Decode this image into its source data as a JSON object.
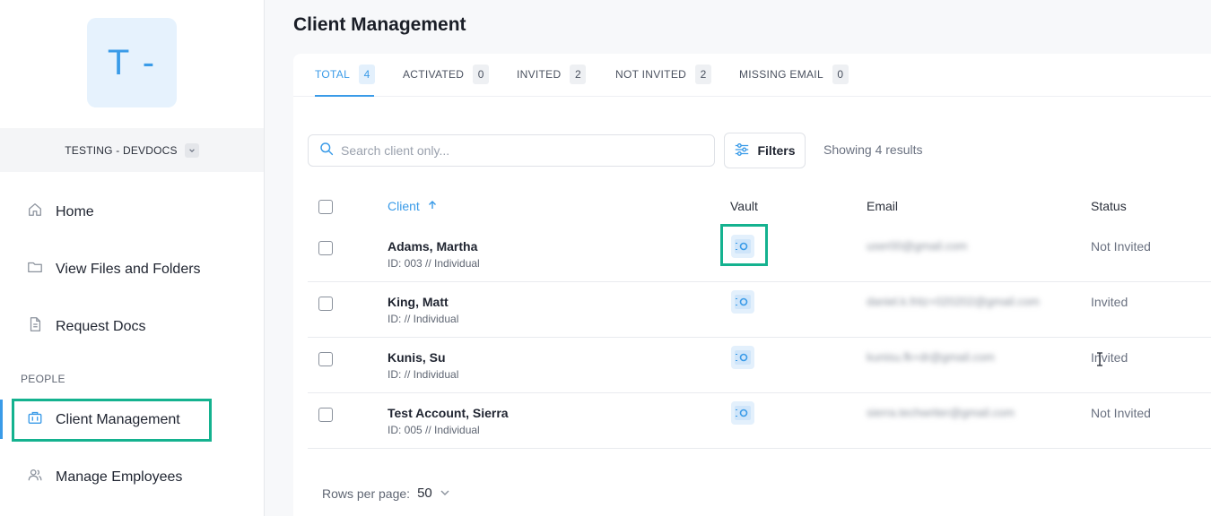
{
  "sidebar": {
    "logo_text": "T -",
    "org_name": "TESTING - DEVDOCS",
    "nav": [
      {
        "label": "Home",
        "icon": "home-icon"
      },
      {
        "label": "View Files and Folders",
        "icon": "folder-icon"
      },
      {
        "label": "Request Docs",
        "icon": "document-icon"
      }
    ],
    "section_people": "PEOPLE",
    "people_nav": [
      {
        "label": "Client Management",
        "icon": "briefcase-icon",
        "active": true
      },
      {
        "label": "Manage Employees",
        "icon": "users-icon"
      }
    ]
  },
  "page": {
    "title": "Client Management"
  },
  "tabs": [
    {
      "label": "TOTAL",
      "count": "4",
      "active": true
    },
    {
      "label": "ACTIVATED",
      "count": "0"
    },
    {
      "label": "INVITED",
      "count": "2"
    },
    {
      "label": "NOT INVITED",
      "count": "2"
    },
    {
      "label": "MISSING EMAIL",
      "count": "0"
    }
  ],
  "toolbar": {
    "search_placeholder": "Search client only...",
    "filters_label": "Filters",
    "results_text": "Showing 4 results"
  },
  "table": {
    "columns": {
      "client": "Client",
      "vault": "Vault",
      "email": "Email",
      "status": "Status"
    },
    "rows": [
      {
        "name": "Adams, Martha",
        "sub": "ID: 003 // Individual",
        "email": "user00@gmail.com",
        "status": "Not Invited"
      },
      {
        "name": "King, Matt",
        "sub": "ID: // Individual",
        "email": "daniel.k.fritz+020202@gmail.com",
        "status": "Invited"
      },
      {
        "name": "Kunis, Su",
        "sub": "ID: // Individual",
        "email": "kunisu.fk+dr@gmail.com",
        "status": "Invited"
      },
      {
        "name": "Test Account, Sierra",
        "sub": "ID: 005 // Individual",
        "email": "sierra.techwriter@gmail.com",
        "status": "Not Invited"
      }
    ]
  },
  "pagination": {
    "rows_per_page_label": "Rows per page:",
    "rows_per_page_value": "50"
  },
  "colors": {
    "accent": "#3a9be8",
    "highlight": "#14b28f"
  }
}
